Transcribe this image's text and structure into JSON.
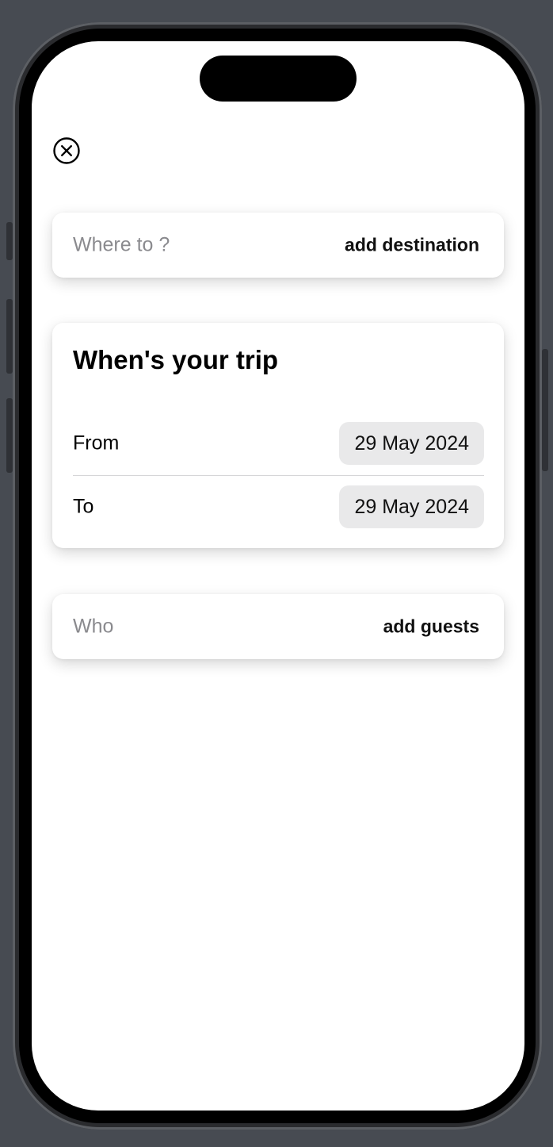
{
  "icons": {
    "close": "close-circle-icon"
  },
  "destination": {
    "label": "Where to ?",
    "action": "add destination"
  },
  "dates": {
    "title": "When's your trip",
    "from": {
      "label": "From",
      "value": "29 May 2024"
    },
    "to": {
      "label": "To",
      "value": "29 May 2024"
    }
  },
  "guests": {
    "label": "Who",
    "action": "add guests"
  },
  "colors": {
    "background": "#474b52",
    "screen": "#ffffff",
    "placeholder_text": "#8a8a8e",
    "date_pill": "#e9e9ea"
  }
}
